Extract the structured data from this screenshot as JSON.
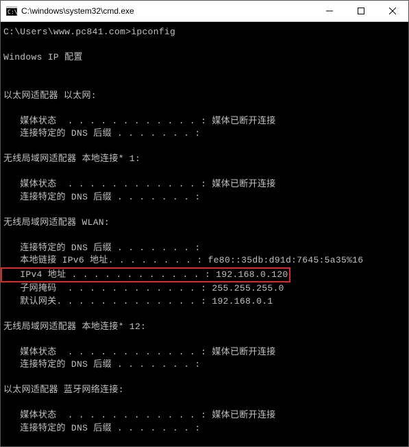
{
  "window": {
    "title": "C:\\windows\\system32\\cmd.exe"
  },
  "terminal": {
    "prompt": "C:\\Users\\www.pc841.com>ipconfig",
    "header": "Windows IP 配置",
    "sections": [
      {
        "title": "以太网适配器 以太网:",
        "lines": [
          {
            "label": "   媒体状态  . . . . . . . . . . . . : ",
            "value": "媒体已断开连接"
          },
          {
            "label": "   连接特定的 DNS 后缀 . . . . . . . : ",
            "value": ""
          }
        ]
      },
      {
        "title": "无线局域网适配器 本地连接* 1:",
        "lines": [
          {
            "label": "   媒体状态  . . . . . . . . . . . . : ",
            "value": "媒体已断开连接"
          },
          {
            "label": "   连接特定的 DNS 后缀 . . . . . . . : ",
            "value": ""
          }
        ]
      },
      {
        "title": "无线局域网适配器 WLAN:",
        "lines": [
          {
            "label": "   连接特定的 DNS 后缀 . . . . . . . : ",
            "value": ""
          },
          {
            "label": "   本地链接 IPv6 地址. . . . . . . . : ",
            "value": "fe80::35db:d91d:7645:5a35%16"
          },
          {
            "label": "   IPv4 地址 . . . . . . . . . . . . : ",
            "value": "192.168.0.120",
            "highlight": true
          },
          {
            "label": "   子网掩码  . . . . . . . . . . . . : ",
            "value": "255.255.255.0"
          },
          {
            "label": "   默认网关. . . . . . . . . . . . . : ",
            "value": "192.168.0.1"
          }
        ]
      },
      {
        "title": "无线局域网适配器 本地连接* 12:",
        "lines": [
          {
            "label": "   媒体状态  . . . . . . . . . . . . : ",
            "value": "媒体已断开连接"
          },
          {
            "label": "   连接特定的 DNS 后缀 . . . . . . . : ",
            "value": ""
          }
        ]
      },
      {
        "title": "以太网适配器 蓝牙网络连接:",
        "lines": [
          {
            "label": "   媒体状态  . . . . . . . . . . . . : ",
            "value": "媒体已断开连接"
          },
          {
            "label": "   连接特定的 DNS 后缀 . . . . . . . : ",
            "value": ""
          }
        ]
      }
    ]
  }
}
